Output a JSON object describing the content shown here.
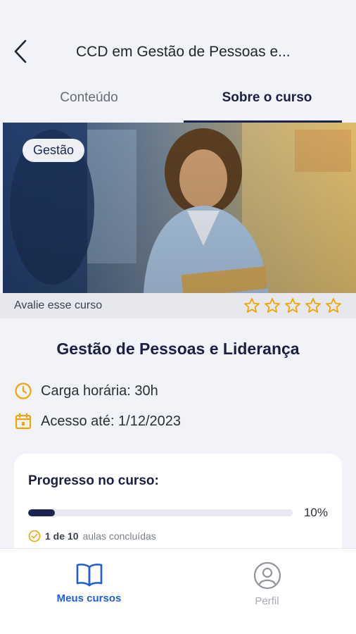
{
  "header": {
    "title": "CCD em Gestão de Pessoas e..."
  },
  "tabs": [
    {
      "label": "Conteúdo",
      "active": false
    },
    {
      "label": "Sobre o curso",
      "active": true
    }
  ],
  "hero": {
    "category": "Gestão"
  },
  "rating": {
    "label": "Avalie esse curso",
    "stars": 5,
    "selected": 0,
    "star_color": "#f0a500"
  },
  "course": {
    "title": "Gestão de Pessoas e Liderança",
    "hours_label": "Carga horária: 30h",
    "access_label": "Acesso até: 1/12/2023",
    "icon_color": "#f0a500"
  },
  "progress": {
    "title": "Progresso no curso:",
    "percent": 10,
    "percent_label": "10%",
    "completed": "1 de 10",
    "completed_suffix": "aulas concluídas",
    "bar_color": "#1b2350"
  },
  "bottom_nav": {
    "courses_label": "Meus cursos",
    "profile_label": "Perfil",
    "active_color": "#1f5fd6",
    "inactive_color": "#a7abb4"
  }
}
